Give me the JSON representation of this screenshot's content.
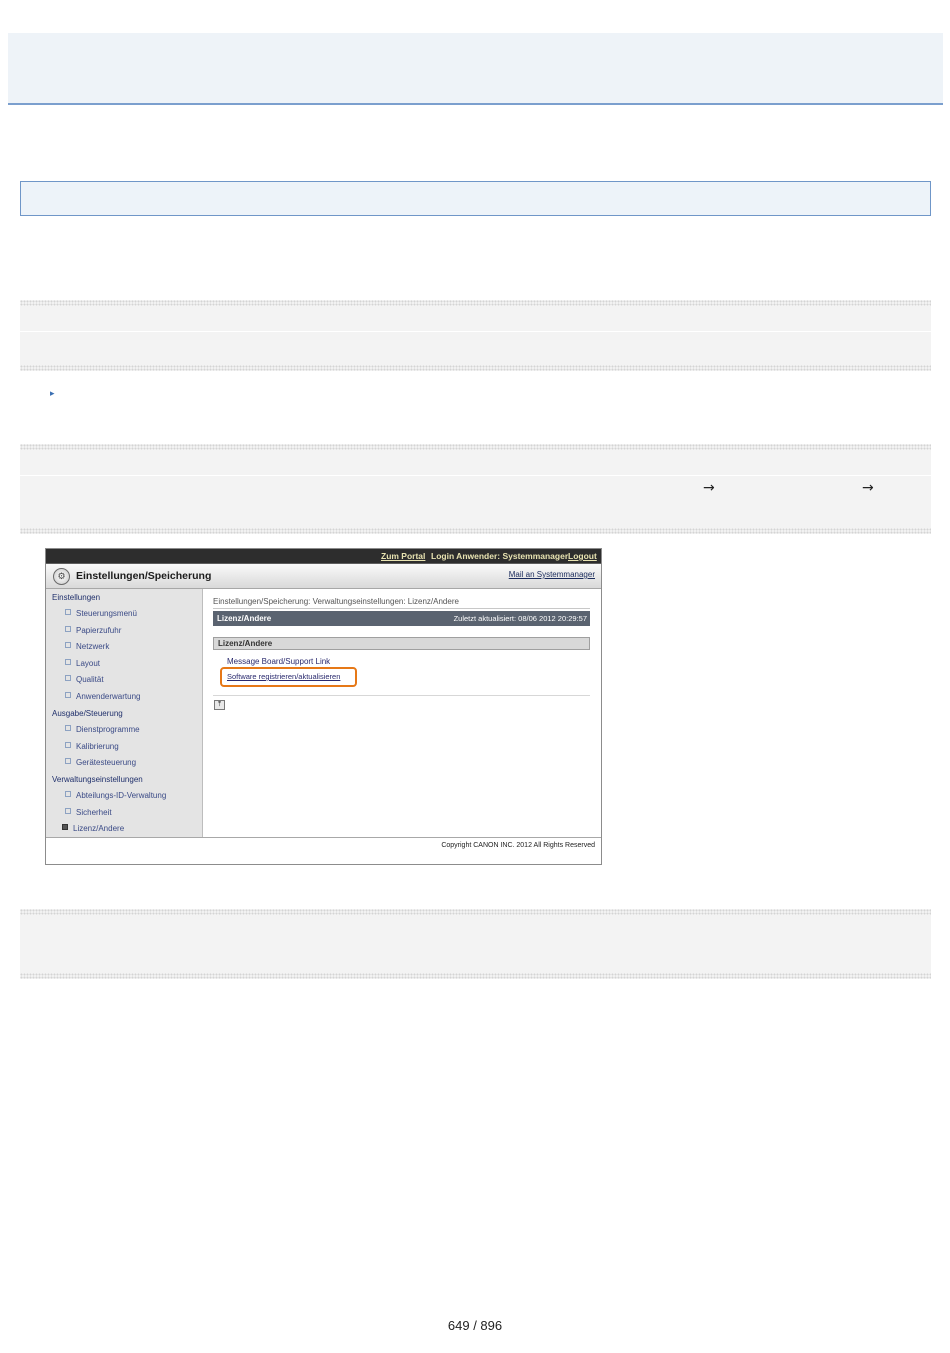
{
  "page": {
    "arrow_1": "→",
    "arrow_2": "→",
    "page_number": "649 / 896"
  },
  "ui": {
    "topbar": {
      "portal": "Zum Portal",
      "login": "Login Anwender: Systemmanager",
      "logout": "Logout"
    },
    "header": {
      "title": "Einstellungen/Speicherung",
      "mail_link": "Mail an Systemmanager"
    },
    "sidebar": {
      "groups": [
        {
          "label": "Einstellungen",
          "items": [
            "Steuerungsmenü",
            "Papierzufuhr",
            "Netzwerk",
            "Layout",
            "Qualität",
            "Anwenderwartung"
          ]
        },
        {
          "label": "Ausgabe/Steuerung",
          "items": [
            "Dienstprogramme",
            "Kalibrierung",
            "Gerätesteuerung"
          ]
        },
        {
          "label": "Verwaltungseinstellungen",
          "items": [
            "Abteilungs-ID-Verwaltung",
            "Sicherheit",
            "Lizenz/Andere"
          ]
        }
      ]
    },
    "main": {
      "breadcrumb": "Einstellungen/Speicherung: Verwaltungseinstellungen: Lizenz/Andere",
      "section_title": "Lizenz/Andere",
      "last_updated": "Zuletzt aktualisiert: 08/06 2012 20:29:57",
      "subsection_title": "Lizenz/Andere",
      "link_message_board": "Message Board/Support Link",
      "link_software": "Software registrieren/aktualisieren"
    },
    "footer": {
      "copyright": "Copyright CANON INC. 2012 All Rights Reserved"
    }
  }
}
